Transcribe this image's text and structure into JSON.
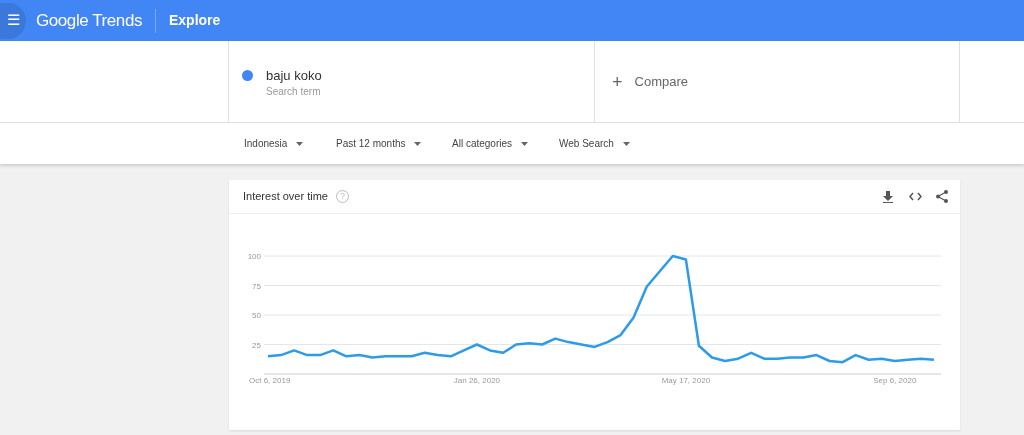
{
  "header": {
    "menu": "☰",
    "logo": "Google Trends",
    "section": "Explore"
  },
  "search_term": {
    "term": "baju koko",
    "subtitle": "Search term",
    "color": "#4285f4"
  },
  "compare": {
    "icon": "+",
    "label": "Compare"
  },
  "filters": [
    {
      "label": "Indonesia"
    },
    {
      "label": "Past 12 months"
    },
    {
      "label": "All categories"
    },
    {
      "label": "Web Search"
    }
  ],
  "card": {
    "title": "Interest over time",
    "help": "?",
    "chart_data": {
      "type": "line",
      "categories": [
        "Oct 6, 2019",
        null,
        null,
        null,
        null,
        null,
        null,
        null,
        null,
        null,
        null,
        null,
        null,
        null,
        null,
        null,
        "Jan 26, 2020",
        null,
        null,
        null,
        null,
        null,
        null,
        null,
        null,
        null,
        null,
        null,
        null,
        null,
        null,
        null,
        "May 17, 2020",
        null,
        null,
        null,
        null,
        null,
        null,
        null,
        null,
        null,
        null,
        null,
        null,
        null,
        null,
        null,
        "Sep 6, 2020",
        null,
        null,
        null
      ],
      "series": [
        {
          "color": "#2d9be8",
          "values": [
            15,
            16,
            20,
            16,
            16,
            20,
            15,
            16,
            14,
            15,
            15,
            15,
            18,
            16,
            15,
            20,
            25,
            20,
            18,
            25,
            26,
            25,
            30,
            27,
            25,
            23,
            27,
            33,
            48,
            74,
            87,
            100,
            97,
            24,
            14,
            11,
            13,
            18,
            13,
            13,
            14,
            14,
            16,
            11,
            10,
            16,
            12,
            13,
            11,
            12,
            13,
            12
          ]
        }
      ],
      "ylim": [
        0,
        100
      ],
      "yticks": [
        25,
        50,
        75,
        100
      ],
      "grid": true
    }
  }
}
